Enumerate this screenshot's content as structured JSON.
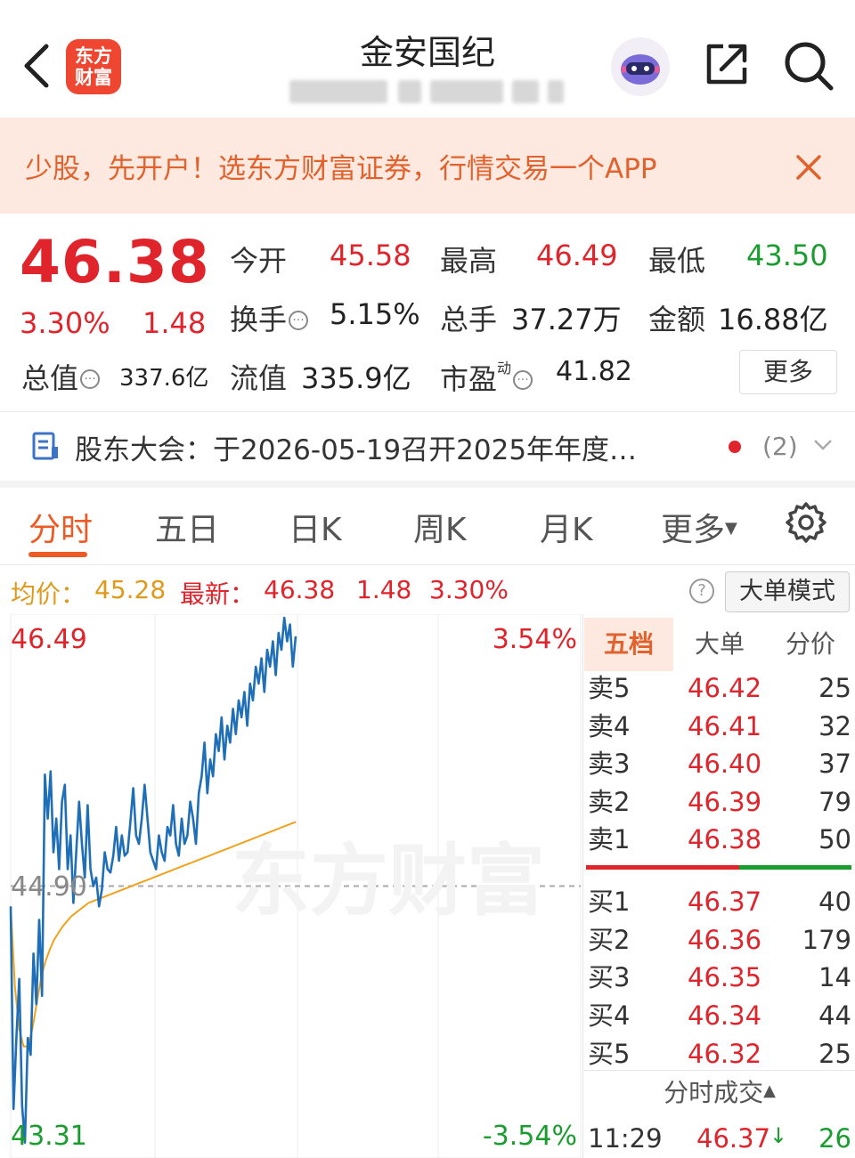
{
  "header": {
    "title": "金安国纪",
    "logo_line1": "东方",
    "logo_line2": "财富"
  },
  "banner": {
    "text": "少股，先开户！选东方财富证券，行情交易一个APP",
    "close": "×"
  },
  "quote": {
    "price": "46.38",
    "change_pct": "3.30%",
    "change": "1.48",
    "open_label": "今开",
    "open": "45.58",
    "high_label": "最高",
    "high": "46.49",
    "low_label": "最低",
    "low": "43.50",
    "turnover_label": "换手",
    "turnover": "5.15%",
    "volume_label": "总手",
    "volume": "37.27万",
    "amount_label": "金额",
    "amount": "16.88亿",
    "mktcap_label": "总值",
    "mktcap": "337.6亿",
    "float_label": "流值",
    "float": "335.9亿",
    "pe_label": "市盈",
    "pe_sup": "动",
    "pe": "41.82",
    "more": "更多"
  },
  "meeting": {
    "text": "股东大会：于2026-05-19召开2025年年度…",
    "count": "(2)"
  },
  "tabs": [
    "分时",
    "五日",
    "日K",
    "周K",
    "月K",
    "更多"
  ],
  "info_row": {
    "avg_label": "均价：",
    "avg": "45.28",
    "latest_label": "最新：",
    "latest": "46.38",
    "change": "1.48",
    "change_pct": "3.30%",
    "mode_button": "大单模式"
  },
  "chart_data": {
    "type": "line",
    "title": "",
    "y_max_label": "46.49",
    "y_min_label": "43.31",
    "pct_max_label": "3.54%",
    "pct_min_label": "-3.54%",
    "prev_close_label": "44.90",
    "ylim": [
      43.31,
      46.49
    ],
    "prev_close": 44.9,
    "time_fraction_end": 0.5,
    "series": [
      {
        "values": [
          44.78,
          43.58,
          44.0,
          44.35,
          43.6,
          43.38,
          44.0,
          43.9,
          44.5,
          44.2,
          44.7,
          44.25,
          45.56,
          45.3,
          45.58,
          45.1,
          45.3,
          45.0,
          45.4,
          45.5,
          45.0,
          45.2,
          44.8,
          45.1,
          45.4,
          45.15,
          44.95,
          45.38,
          45.0,
          44.9,
          44.95,
          44.78,
          44.88,
          45.1,
          45.0,
          44.98,
          45.08,
          45.25,
          45.05,
          45.2,
          45.08,
          45.1,
          45.28,
          45.48,
          45.2,
          45.15,
          45.3,
          45.5,
          45.3,
          45.1,
          45.05,
          45.0,
          45.2,
          45.1,
          45.05,
          45.25,
          45.2,
          45.38,
          45.15,
          45.08,
          45.3,
          45.15,
          45.2,
          45.4,
          45.3,
          45.15,
          45.45,
          45.55,
          45.75,
          45.45,
          45.65,
          45.55,
          45.8,
          45.7,
          45.9,
          45.65,
          45.85,
          45.75,
          45.95,
          45.8,
          46.0,
          45.9,
          46.05,
          45.85,
          46.1,
          46.0,
          46.2,
          46.1,
          46.25,
          46.05,
          46.3,
          46.2,
          46.35,
          46.15,
          46.4,
          46.3,
          46.49,
          46.35,
          46.45,
          46.2,
          46.38
        ]
      },
      {
        "values": [
          44.78,
          44.3,
          44.05,
          43.95,
          43.95,
          44.05,
          44.2,
          44.35,
          44.45,
          44.52,
          44.58,
          44.62,
          44.66,
          44.69,
          44.72,
          44.74,
          44.76,
          44.78,
          44.8,
          44.81,
          44.82,
          44.83,
          44.84,
          44.85,
          44.86,
          44.87,
          44.88,
          44.89,
          44.9,
          44.91,
          44.92,
          44.93,
          44.94,
          44.95,
          44.96,
          44.97,
          44.98,
          44.99,
          45.0,
          45.01,
          45.02,
          45.03,
          45.04,
          45.05,
          45.06,
          45.07,
          45.08,
          45.09,
          45.1,
          45.11,
          45.12,
          45.13,
          45.14,
          45.15,
          45.16,
          45.17,
          45.18,
          45.19,
          45.2,
          45.21,
          45.22,
          45.23,
          45.24,
          45.25,
          45.26,
          45.27,
          45.28
        ]
      }
    ],
    "colors": {
      "price": "#1f6fb8",
      "avg": "#f0a21c"
    }
  },
  "order_book": {
    "tabs": [
      "五档",
      "大单",
      "分价"
    ],
    "asks": [
      {
        "label": "卖5",
        "price": "46.42",
        "vol": "25"
      },
      {
        "label": "卖4",
        "price": "46.41",
        "vol": "32"
      },
      {
        "label": "卖3",
        "price": "46.40",
        "vol": "37"
      },
      {
        "label": "卖2",
        "price": "46.39",
        "vol": "79"
      },
      {
        "label": "卖1",
        "price": "46.38",
        "vol": "50"
      }
    ],
    "bids": [
      {
        "label": "买1",
        "price": "46.37",
        "vol": "40"
      },
      {
        "label": "买2",
        "price": "46.36",
        "vol": "179"
      },
      {
        "label": "买3",
        "price": "46.35",
        "vol": "14"
      },
      {
        "label": "买4",
        "price": "46.34",
        "vol": "44"
      },
      {
        "label": "买5",
        "price": "46.32",
        "vol": "25"
      }
    ],
    "trades_header": "分时成交",
    "trade": {
      "time": "11:29",
      "price": "46.37",
      "vol": "26"
    }
  },
  "colors": {
    "up": "#e0242b",
    "down": "#1a9d2f",
    "accent": "#ee5a24"
  }
}
